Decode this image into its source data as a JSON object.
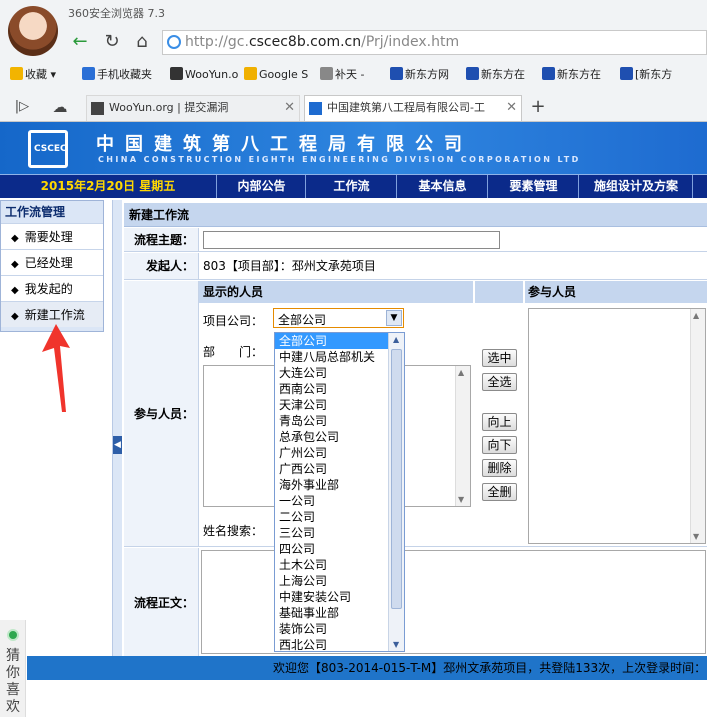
{
  "browser": {
    "title": "360安全浏览器 7.3",
    "url_prefix": "http://gc.",
    "url_host": "cscec8b.com.cn",
    "url_path": "/Prj/index.htm",
    "bookmarks": [
      "收藏",
      "手机收藏夹",
      "WooYun.o",
      "Google S",
      "补天 -",
      "新东方网",
      "新东方在",
      "新东方在",
      "[新东方"
    ],
    "tabs": [
      {
        "label": "WooYun.org | 提交漏洞"
      },
      {
        "label": "中国建筑第八工程局有限公司-工"
      }
    ],
    "new_tab": "+"
  },
  "site": {
    "logo_text": "CSCEC",
    "title": "中国建筑第八工程局有限公司",
    "subtitle": "CHINA CONSTRUCTION EIGHTH ENGINEERING DIVISION CORPORATION LTD",
    "date": "2015年2月20日 星期五",
    "menu": [
      "内部公告",
      "工作流",
      "基本信息",
      "要素管理",
      "施组设计及方案"
    ]
  },
  "sidebar": {
    "title": "工作流管理",
    "items": [
      "需要处理",
      "已经处理",
      "我发起的",
      "新建工作流"
    ]
  },
  "form": {
    "header": "新建工作流",
    "subject_label": "流程主题：",
    "subject_value": "",
    "initiator_label": "发起人：",
    "initiator_value": "803【项目部】：邳州文承苑项目",
    "participants_label": "参与人员：",
    "shown_people_header": "显示的人员",
    "selected_people_header": "参与人员",
    "company_label": "项目公司：",
    "company_selected": "全部公司",
    "department_label": "部　　门：",
    "name_search_label": "姓名搜索：",
    "body_label": "流程正文：",
    "buttons": [
      "选中",
      "全选",
      "向上",
      "向下",
      "删除",
      "全删"
    ]
  },
  "dropdown_options": [
    "全部公司",
    "中建八局总部机关",
    "大连公司",
    "西南公司",
    "天津公司",
    "青岛公司",
    "总承包公司",
    "广州公司",
    "广西公司",
    "海外事业部",
    "一公司",
    "二公司",
    "三公司",
    "四公司",
    "土木公司",
    "上海公司",
    "中建安装公司",
    "基础事业部",
    "装饰公司",
    "西北公司"
  ],
  "footer": {
    "text": "欢迎您【803-2014-015-T-M】邳州文承苑项目，共登陆133次，上次登录时间："
  },
  "side_widget": {
    "label": "猜你喜欢"
  },
  "colors": {
    "banner": "#2f86e0",
    "menubar": "#0b2a8a",
    "date_text": "#ffd800",
    "dropdown_selected": "#3399ff",
    "footer": "#1f74c9"
  }
}
